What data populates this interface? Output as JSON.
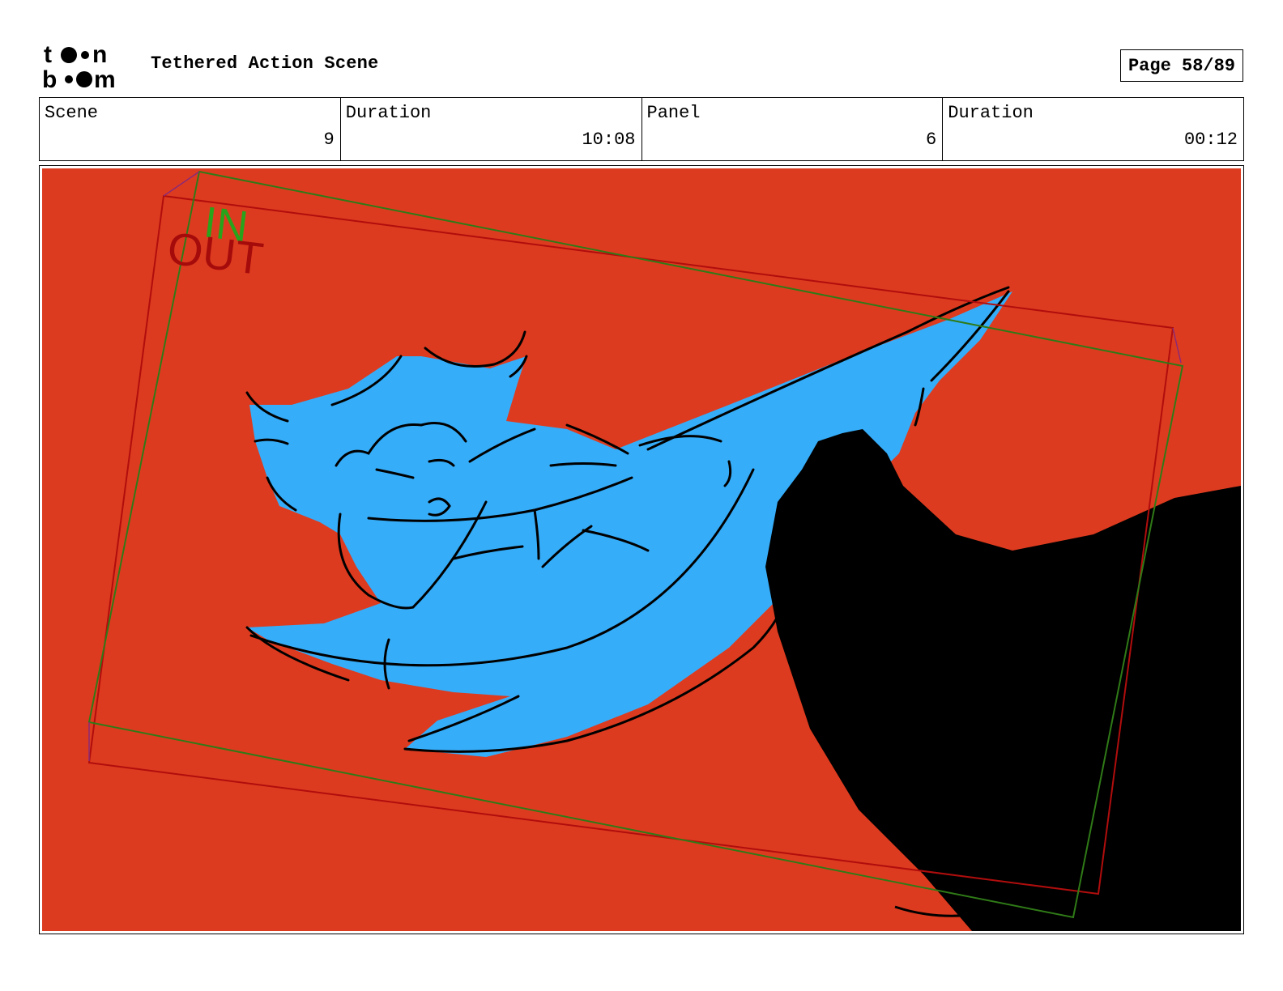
{
  "header": {
    "logo": {
      "line1": "toon",
      "line2": "boom"
    },
    "title": "Tethered Action Scene",
    "page_label": "Page 58/89"
  },
  "info": [
    {
      "label": "Scene",
      "value": "9"
    },
    {
      "label": "Duration",
      "value": "10:08"
    },
    {
      "label": "Panel",
      "value": "6"
    },
    {
      "label": "Duration",
      "value": "00:12"
    }
  ],
  "panel": {
    "in_label": "IN",
    "out_label": "OUT",
    "colors": {
      "background": "#dd3b1f",
      "character": "#36adf9",
      "shadow": "#000000",
      "in_frame": "#2f7a17",
      "out_frame": "#b00d0d",
      "in_text": "#2aa31c",
      "out_text": "#a50b0b"
    }
  }
}
